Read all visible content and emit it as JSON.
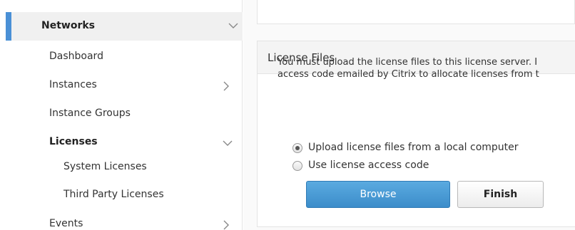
{
  "sidebar": {
    "section": {
      "label": "Networks"
    },
    "items": [
      {
        "label": "Dashboard"
      },
      {
        "label": "Instances"
      },
      {
        "label": "Instance Groups"
      },
      {
        "label": "Licenses"
      },
      {
        "label": "System Licenses"
      },
      {
        "label": "Third Party Licenses"
      },
      {
        "label": "Events"
      }
    ]
  },
  "main": {
    "card": {
      "title": "License Files",
      "description_line1": "You must upload the license files to this license server. I",
      "description_line2": "access code emailed by Citrix to allocate licenses from t",
      "options": [
        {
          "label": "Upload license files from a local computer",
          "checked": true
        },
        {
          "label": "Use license access code",
          "checked": false
        }
      ],
      "browse_label": "Browse",
      "finish_label": "Finish"
    }
  },
  "colors": {
    "accent": "#4a90d6",
    "primary_button": "#4a9cd6"
  },
  "icons": [
    "chevron-down-icon",
    "chevron-right-icon"
  ]
}
